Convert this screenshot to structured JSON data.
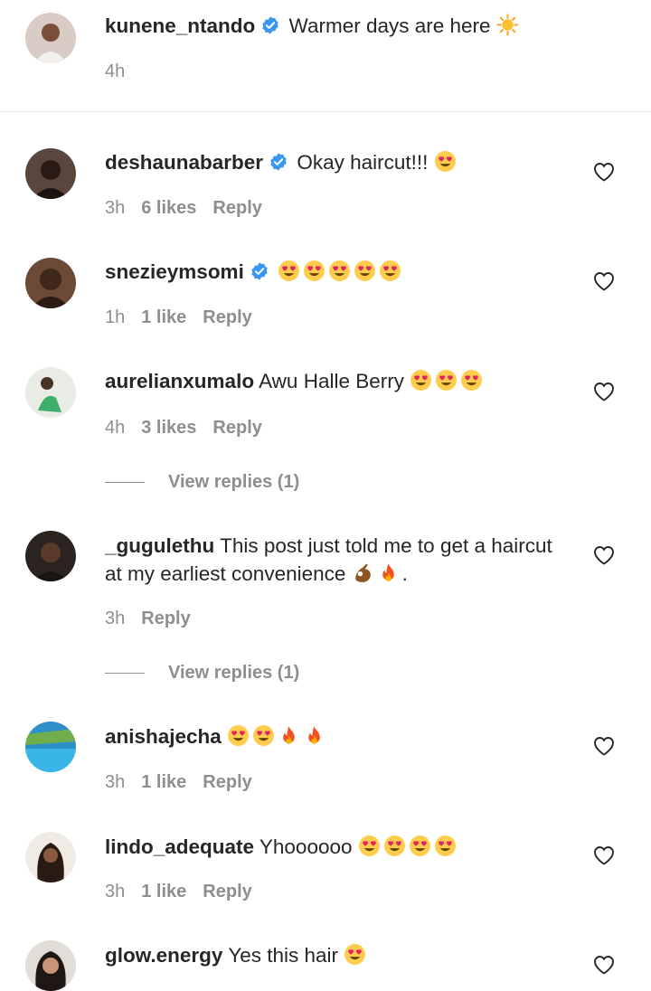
{
  "caption": {
    "username": "kunene_ntando",
    "verified": true,
    "text": "Warmer days are here",
    "emoji": [
      "sun"
    ],
    "time": "4h",
    "avatar_color": "#c9b8ad"
  },
  "comments": [
    {
      "username": "deshaunabarber",
      "verified": true,
      "text": "Okay haircut!!!",
      "emoji": [
        "heart-eyes"
      ],
      "time": "3h",
      "likes": "6 likes",
      "reply": "Reply",
      "avatar_color": "#3a2a22"
    },
    {
      "username": "snezieymsomi",
      "verified": true,
      "text": "",
      "emoji": [
        "heart-eyes",
        "heart-eyes",
        "heart-eyes",
        "heart-eyes",
        "heart-eyes"
      ],
      "time": "1h",
      "likes": "1 like",
      "reply": "Reply",
      "avatar_color": "#4a3325"
    },
    {
      "username": "aurelianxumalo",
      "verified": false,
      "text": "Awu Halle Berry",
      "emoji": [
        "heart-eyes",
        "heart-eyes",
        "heart-eyes"
      ],
      "time": "4h",
      "likes": "3 likes",
      "reply": "Reply",
      "view_replies": "View replies (1)",
      "avatar_color": "#dfe6da"
    },
    {
      "username": "_gugulethu",
      "verified": false,
      "text": "This post just told me to get a haircut at my earliest convenience",
      "emoji": [
        "ok-hand",
        "fire"
      ],
      "trailing": ".",
      "time": "3h",
      "likes": "",
      "reply": "Reply",
      "view_replies": "View replies (1)",
      "avatar_color": "#2a1d18"
    },
    {
      "username": "anishajecha",
      "verified": false,
      "text": "",
      "emoji": [
        "heart-eyes",
        "heart-eyes",
        "fire",
        "fire"
      ],
      "time": "3h",
      "likes": "1 like",
      "reply": "Reply",
      "avatar_color": "#2f8fc9"
    },
    {
      "username": "lindo_adequate",
      "verified": false,
      "text": "Yhoooooo",
      "emoji": [
        "heart-eyes",
        "heart-eyes",
        "heart-eyes",
        "heart-eyes"
      ],
      "time": "3h",
      "likes": "1 like",
      "reply": "Reply",
      "avatar_color": "#3b2620"
    },
    {
      "username": "glow.energy",
      "verified": false,
      "text": "Yes this hair",
      "emoji": [
        "heart-eyes"
      ],
      "time": "",
      "likes": "",
      "reply": "",
      "avatar_color": "#d9d2cc"
    }
  ],
  "colors": {
    "text": "#262626",
    "muted": "#8e8e8e",
    "verified": "#3897f0",
    "divider": "#e6e6e6"
  }
}
